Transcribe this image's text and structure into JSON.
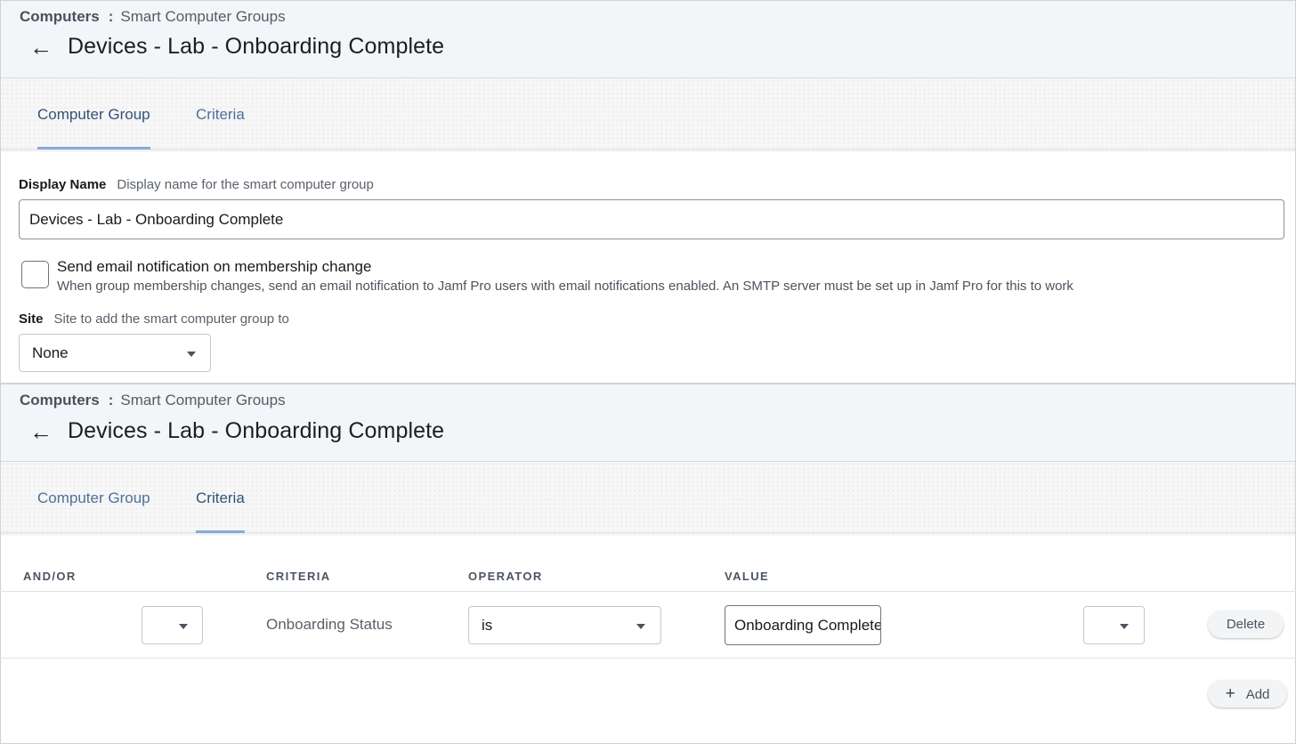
{
  "breadcrumb": {
    "root": "Computers",
    "sep": ":",
    "current": "Smart Computer Groups"
  },
  "page_title": "Devices - Lab - Onboarding Complete",
  "tabs": [
    {
      "label": "Computer Group"
    },
    {
      "label": "Criteria"
    }
  ],
  "form": {
    "display_name_label": "Display Name",
    "display_name_hint": "Display name for the smart computer group",
    "display_name_value": "Devices - Lab - Onboarding Complete",
    "email_checkbox_title": "Send email notification on membership change",
    "email_checkbox_desc": "When group membership changes, send an email notification to Jamf Pro users with email notifications enabled. An SMTP server must be set up in Jamf Pro for this to work",
    "email_checked": false,
    "site_label": "Site",
    "site_hint": "Site to add the smart computer group to",
    "site_value": "None"
  },
  "criteria_table": {
    "headers": {
      "and_or": "AND/OR",
      "criteria": "CRITERIA",
      "operator": "OPERATOR",
      "value": "VALUE"
    },
    "rows": [
      {
        "and_or": "",
        "criteria": "Onboarding Status",
        "operator": "is",
        "value": "Onboarding Complete",
        "paren": "",
        "delete_label": "Delete"
      }
    ],
    "add_label": "Add"
  },
  "icons": {
    "back": "back-arrow-icon",
    "caret": "caret-down-icon",
    "plus": "plus-icon"
  },
  "colors": {
    "tab_text": "#4f6f9a",
    "tab_active_underline": "#89a9d6",
    "header_bg": "#f3f5f9"
  }
}
